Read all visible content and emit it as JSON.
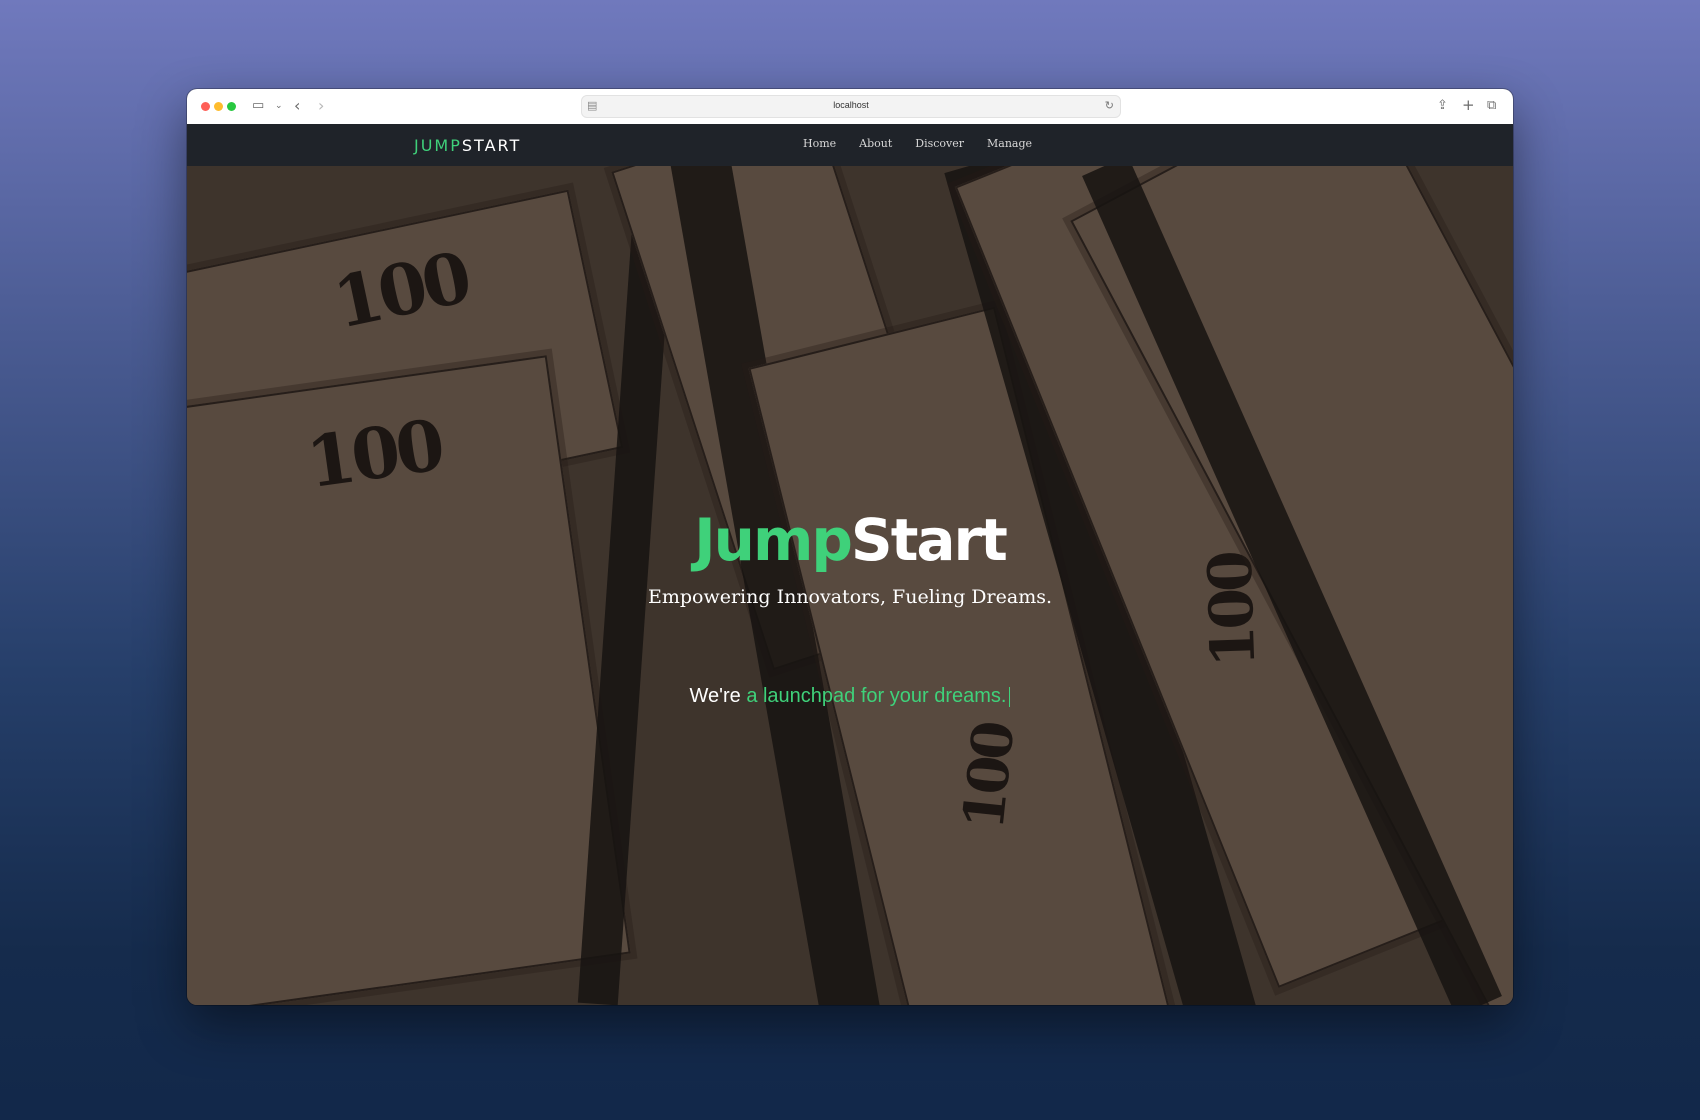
{
  "browser": {
    "url": "localhost",
    "icons": {
      "sidebar": "sidebar-icon",
      "back": "chevron-left-icon",
      "forward": "chevron-right-icon",
      "share": "share-icon",
      "new_tab": "plus-icon",
      "tabs": "tabs-overview-icon",
      "reload": "reload-icon"
    }
  },
  "nav": {
    "logo_left": "JUMP",
    "logo_right": "START",
    "links": [
      "Home",
      "About",
      "Discover",
      "Manage"
    ]
  },
  "hero": {
    "title_green": "Jump",
    "title_white": "Start",
    "tagline": "Empowering Innovators, Fueling Dreams.",
    "sub_prefix": "We're ",
    "sub_highlight": "a launchpad for your dreams."
  },
  "colors": {
    "accent": "#3fd17a",
    "nav_bg": "#1f2329"
  }
}
